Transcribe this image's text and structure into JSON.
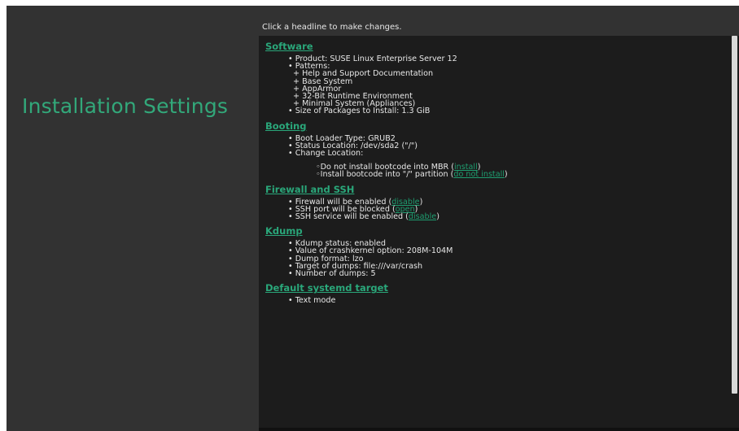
{
  "screen": {
    "left_title": "Installation Settings",
    "hint": "Click a headline to make changes."
  },
  "sections": {
    "software": {
      "title": "Software",
      "product": "• Product: SUSE Linux Enterprise Server 12",
      "patterns": "• Patterns:",
      "pattern_items": [
        "+ Help and Support Documentation",
        "+ Base System",
        "+ AppArmor",
        "+ 32-Bit Runtime Environment",
        "+ Minimal System (Appliances)"
      ],
      "size": "• Size of Packages to Install: 1.3 GiB"
    },
    "booting": {
      "title": "Booting",
      "loader": "• Boot Loader Type: GRUB2",
      "status": "• Status Location: /dev/sda2 (\"/\")",
      "change": "• Change Location:",
      "opt1_text": "◦Do not install bootcode into MBR (",
      "opt1_link": "install",
      "opt1_end": ")",
      "opt2_text": "◦Install bootcode into \"/\" partition (",
      "opt2_link": "do not install",
      "opt2_end": ")"
    },
    "firewall": {
      "title": "Firewall and SSH",
      "fw_text": "• Firewall will be enabled (",
      "fw_link": "disable",
      "fw_end": ")",
      "port_text": "• SSH port will be blocked (",
      "port_link": "open",
      "port_end": ")",
      "svc_text": "• SSH service will be enabled (",
      "svc_link": "disable",
      "svc_end": ")"
    },
    "kdump": {
      "title": "Kdump",
      "items": [
        "• Kdump status: enabled",
        "• Value of crashkernel option: 208M-104M",
        "• Dump format: lzo",
        "• Target of dumps: file:///var/crash",
        "• Number of dumps: 5"
      ]
    },
    "systemd": {
      "title": "Default systemd target",
      "item": "• Text mode"
    }
  },
  "colors": {
    "accent": "#2aa77a",
    "background": "#323232",
    "panel": "#1c1c1c"
  }
}
